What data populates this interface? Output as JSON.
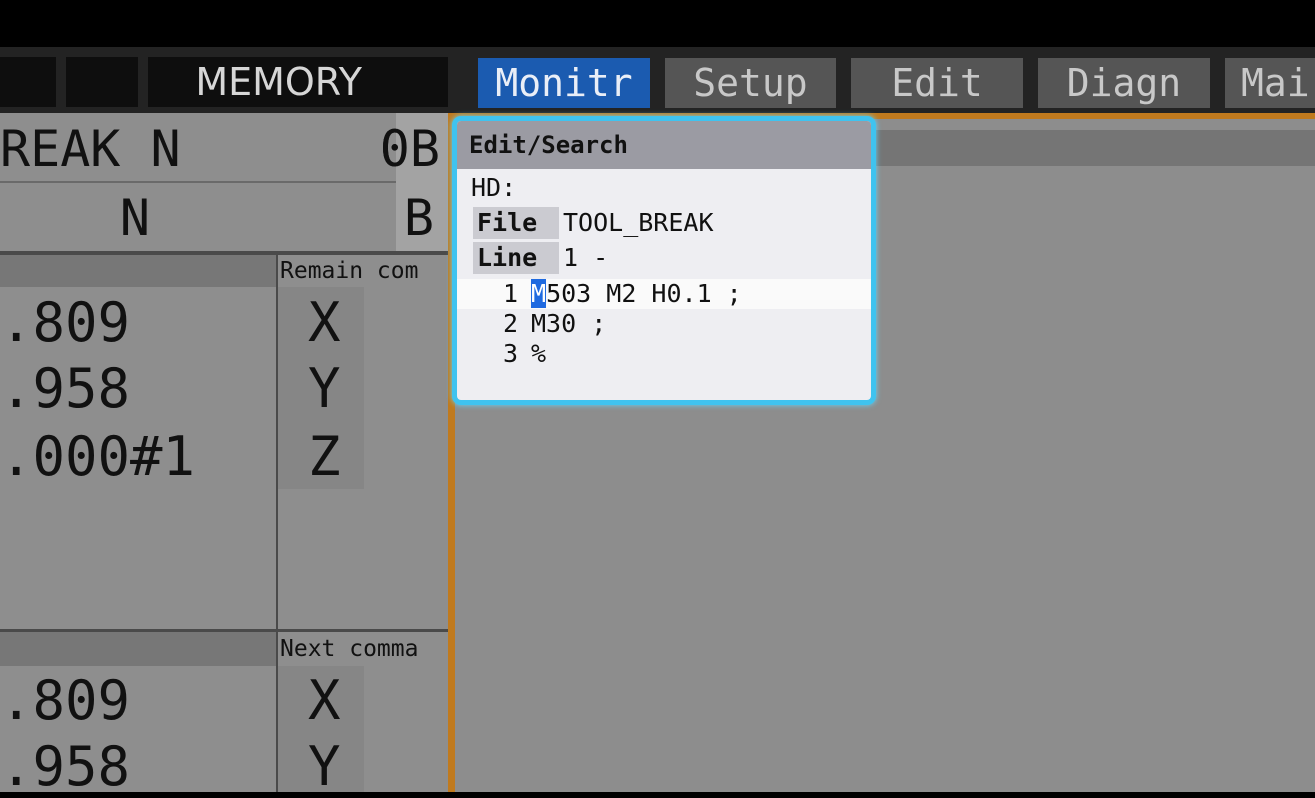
{
  "tabs": {
    "mode": "MEMORY",
    "items": [
      "Monitr",
      "Setup",
      "Edit",
      "Diagn",
      "Mai"
    ],
    "active": "Monitr"
  },
  "left_panel": {
    "program_row1": {
      "name": "REAK N",
      "value": "0B"
    },
    "program_row2": {
      "name": "N",
      "value": "B"
    },
    "remain_header": "Remain com",
    "next_header": "Next comma",
    "upper_values": [
      ".809",
      ".958",
      ".000#1"
    ],
    "upper_axes": [
      "X",
      "Y",
      "Z"
    ],
    "lower_values": [
      ".809",
      ".958"
    ],
    "lower_axes": [
      "X",
      "Y"
    ]
  },
  "dialog": {
    "title": "Edit/Search",
    "device": "HD:",
    "file_label": "File",
    "file_value": "TOOL_BREAK",
    "line_label": "Line",
    "line_value": "1 -",
    "program_lines": [
      {
        "num": "1",
        "cursor": "M",
        "rest": "503 M2 H0.1 ;"
      },
      {
        "num": "2",
        "text": "M30 ;"
      },
      {
        "num": "3",
        "text": "%"
      }
    ]
  },
  "colors": {
    "active_tab": "#1b5bb0",
    "dialog_border": "#3fc3ef",
    "orange_frame": "#c07a1e"
  }
}
